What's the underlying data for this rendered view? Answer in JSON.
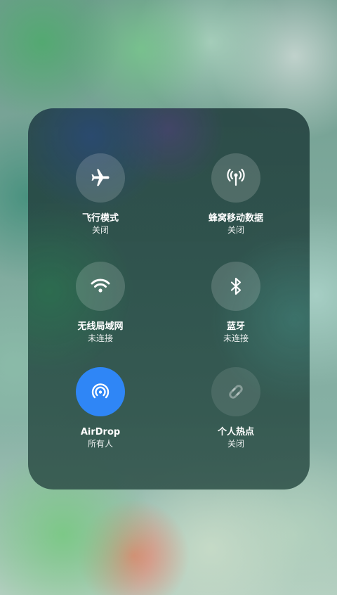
{
  "control_panel": {
    "tiles": [
      {
        "label": "飞行模式",
        "state": "关闭",
        "icon": "airplane-icon",
        "active": false
      },
      {
        "label": "蜂窝移动数据",
        "state": "关闭",
        "icon": "cellular-antenna-icon",
        "active": false
      },
      {
        "label": "无线局域网",
        "state": "未连接",
        "icon": "wifi-icon",
        "active": false
      },
      {
        "label": "蓝牙",
        "state": "未连接",
        "icon": "bluetooth-icon",
        "active": false
      },
      {
        "label": "AirDrop",
        "state": "所有人",
        "icon": "airdrop-icon",
        "active": true
      },
      {
        "label": "个人热点",
        "state": "关闭",
        "icon": "hotspot-link-icon",
        "active": false
      }
    ],
    "colors": {
      "active": "#2f86f6"
    }
  }
}
